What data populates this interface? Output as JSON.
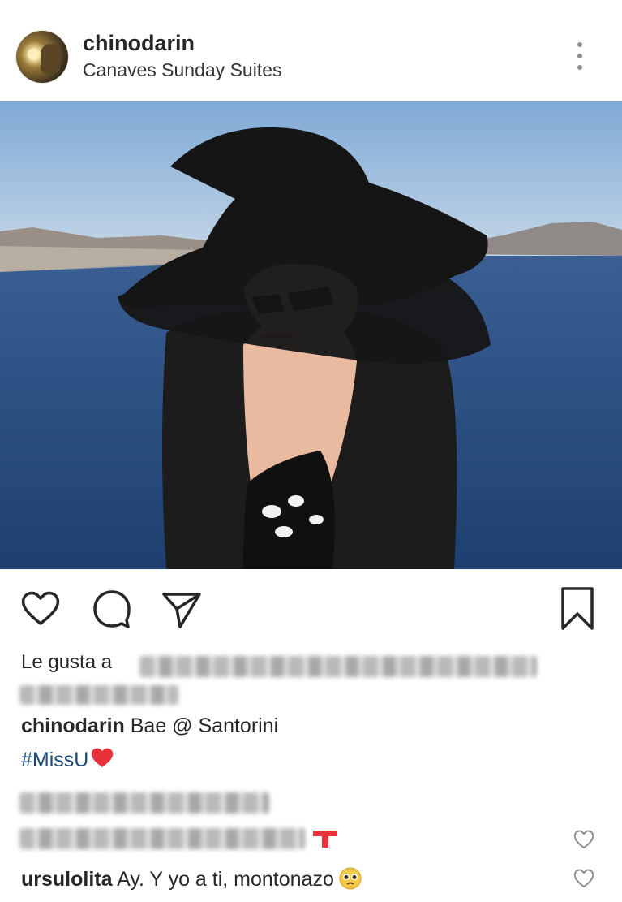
{
  "post": {
    "username": "chinodarin",
    "location": "Canaves Sunday Suites"
  },
  "actions": {
    "like_icon": "heart-icon",
    "comment_icon": "comment-icon",
    "share_icon": "send-icon",
    "save_icon": "bookmark-icon"
  },
  "likes": {
    "prefix": "Le gusta a"
  },
  "caption": {
    "username": "chinodarin",
    "text": "Bae @ Santorini",
    "hashtag": "#MissU"
  },
  "comments": [
    {
      "username": "ursulolita",
      "text": "Ay. Y yo a ti, montonazo"
    }
  ],
  "colors": {
    "text": "#262626",
    "hashtag": "#1a4a7a",
    "heart_emoji": "#e8313a",
    "icon": "#262626",
    "blur": "#c9c9c9"
  }
}
